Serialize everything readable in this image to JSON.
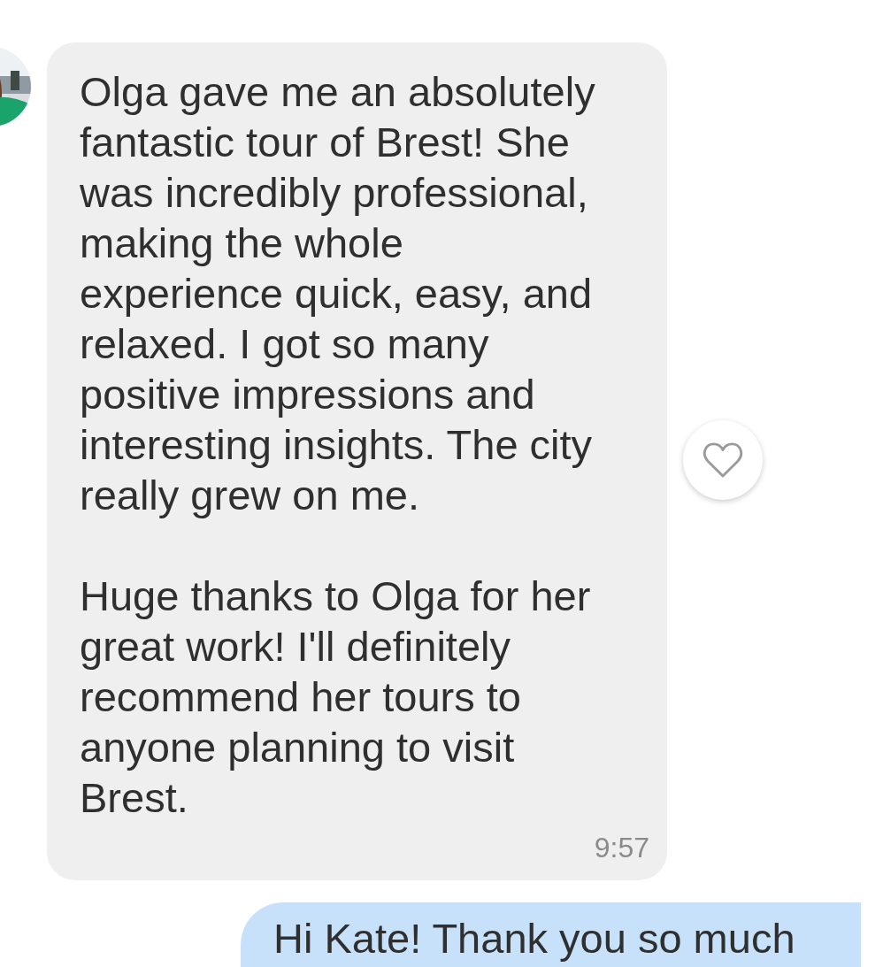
{
  "messages": [
    {
      "kind": "incoming",
      "paragraphs": [
        "Olga gave me an absolutely\nfantastic tour of Brest! She\nwas incredibly professional,\nmaking the whole\nexperience quick, easy, and\nrelaxed. I got so many\npositive impressions and\ninteresting insights. The city\nreally grew on me.",
        "Huge thanks to Olga for her\ngreat work! I'll definitely\nrecommend her tours to\nanyone planning to visit\nBrest."
      ],
      "time": "9:57",
      "liked": false
    },
    {
      "kind": "outgoing",
      "paragraphs": [
        "Hi Kate! Thank you so much"
      ]
    }
  ]
}
